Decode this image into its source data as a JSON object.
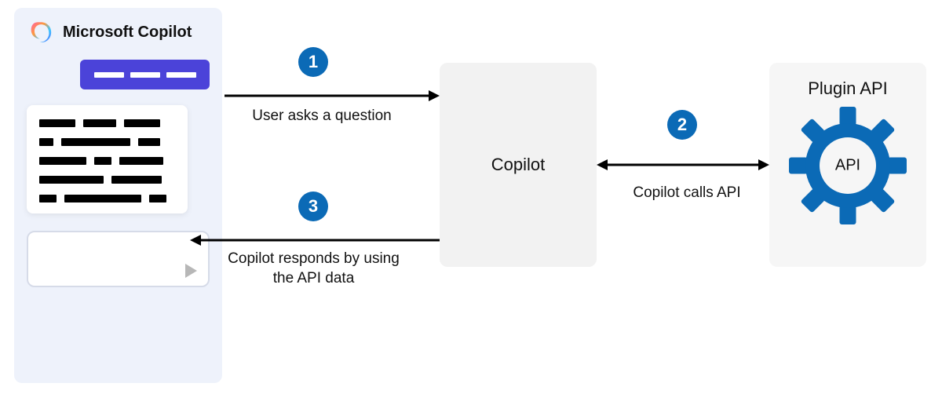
{
  "panel": {
    "title": "Microsoft Copilot"
  },
  "copilot": {
    "label": "Copilot"
  },
  "plugin": {
    "title": "Plugin API",
    "gear_label": "API"
  },
  "steps": {
    "s1": {
      "num": "1",
      "label": "User asks a question"
    },
    "s2": {
      "num": "2",
      "label": "Copilot calls API"
    },
    "s3": {
      "num": "3",
      "label": "Copilot responds by using the API data"
    }
  },
  "colors": {
    "accent_blue": "#0b6ab6",
    "user_bubble": "#4b43d9",
    "panel_bg": "#eef2fb"
  }
}
